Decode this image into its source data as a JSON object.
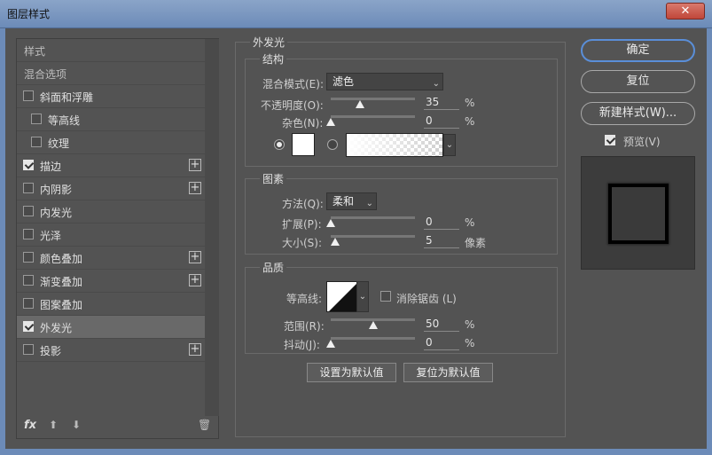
{
  "window": {
    "title": "图层样式",
    "close_label": "✕"
  },
  "sidebar": {
    "header": "样式",
    "blend_options": "混合选项",
    "items": [
      {
        "label": "斜面和浮雕",
        "checked": false,
        "has_plus": false,
        "indent": 0
      },
      {
        "label": "等高线",
        "checked": false,
        "has_plus": false,
        "indent": 1
      },
      {
        "label": "纹理",
        "checked": false,
        "has_plus": false,
        "indent": 1
      },
      {
        "label": "描边",
        "checked": true,
        "has_plus": true,
        "indent": 0
      },
      {
        "label": "内阴影",
        "checked": false,
        "has_plus": true,
        "indent": 0
      },
      {
        "label": "内发光",
        "checked": false,
        "has_plus": false,
        "indent": 0
      },
      {
        "label": "光泽",
        "checked": false,
        "has_plus": false,
        "indent": 0
      },
      {
        "label": "颜色叠加",
        "checked": false,
        "has_plus": true,
        "indent": 0
      },
      {
        "label": "渐变叠加",
        "checked": false,
        "has_plus": true,
        "indent": 0
      },
      {
        "label": "图案叠加",
        "checked": false,
        "has_plus": false,
        "indent": 0
      },
      {
        "label": "外发光",
        "checked": true,
        "has_plus": false,
        "indent": 0,
        "selected": true
      },
      {
        "label": "投影",
        "checked": false,
        "has_plus": true,
        "indent": 0
      }
    ],
    "footer": {
      "fx": "fx",
      "up_icon": "arrow-up-icon",
      "down_icon": "arrow-down-icon",
      "trash_icon": "trash-icon"
    }
  },
  "panel": {
    "title": "外发光",
    "structure": {
      "title": "结构",
      "blend_mode_label": "混合模式(E):",
      "blend_mode_value": "滤色",
      "opacity_label": "不透明度(O):",
      "opacity_value": "35",
      "opacity_unit": "%",
      "noise_label": "杂色(N):",
      "noise_value": "0",
      "noise_unit": "%"
    },
    "elements": {
      "title": "图素",
      "technique_label": "方法(Q):",
      "technique_value": "柔和",
      "spread_label": "扩展(P):",
      "spread_value": "0",
      "spread_unit": "%",
      "size_label": "大小(S):",
      "size_value": "5",
      "size_unit": "像素"
    },
    "quality": {
      "title": "品质",
      "contour_label": "等高线:",
      "antialias_label": "消除锯齿 (L)",
      "range_label": "范围(R):",
      "range_value": "50",
      "range_unit": "%",
      "jitter_label": "抖动(J):",
      "jitter_value": "0",
      "jitter_unit": "%"
    },
    "make_default": "设置为默认值",
    "reset_default": "复位为默认值"
  },
  "actions": {
    "ok": "确定",
    "reset": "复位",
    "new_style": "新建样式(W)...",
    "preview_label": "预览(V)",
    "preview_checked": true
  }
}
